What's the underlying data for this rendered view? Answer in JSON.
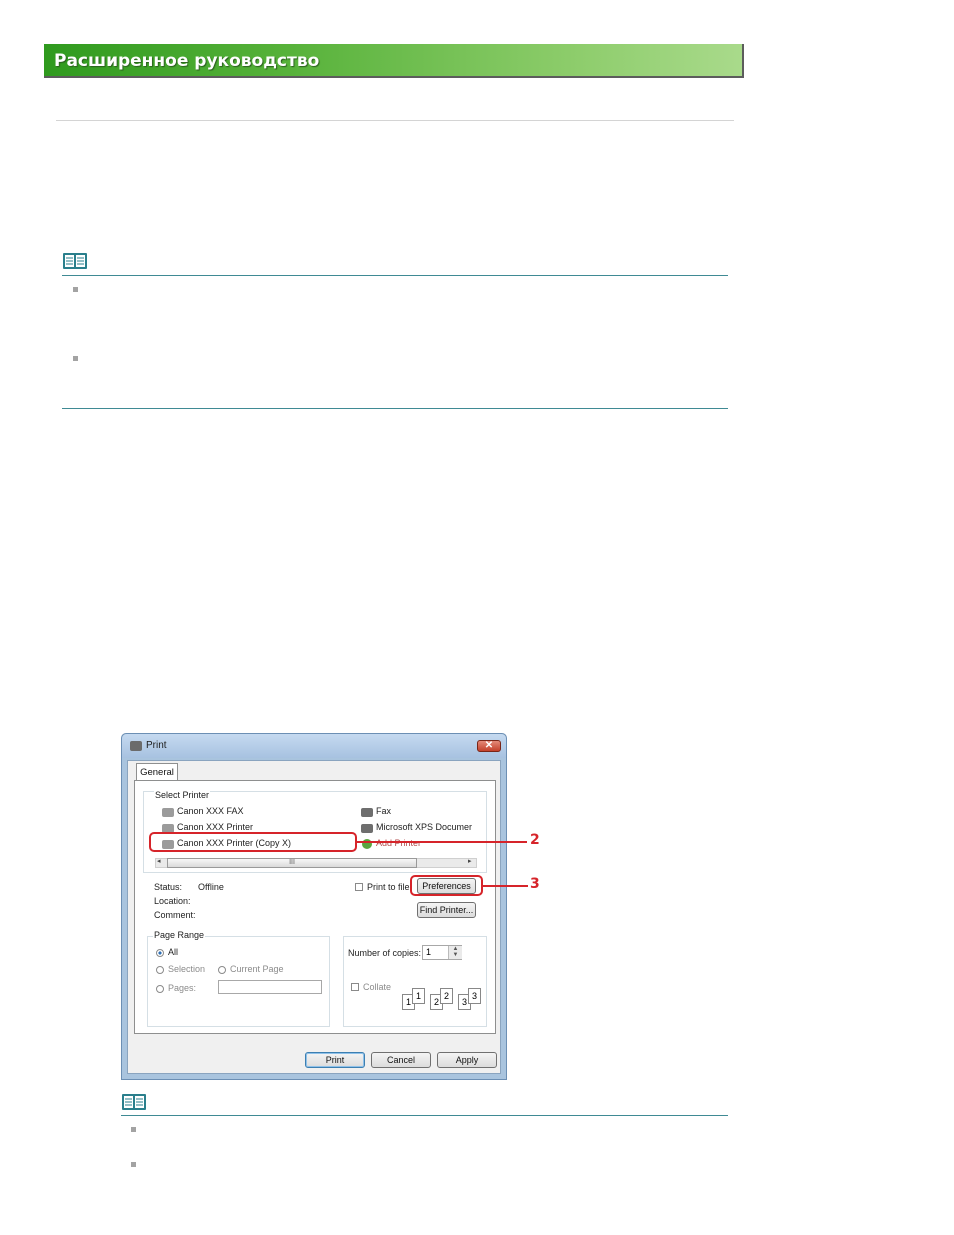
{
  "header": {
    "title": "Расширенное руководство"
  },
  "dialog": {
    "title": "Print",
    "close_label": "✕",
    "tab_general": "General",
    "select_printer_label": "Select Printer",
    "printers_left": [
      "Canon XXX FAX",
      "Canon XXX Printer",
      "Canon XXX Printer (Copy X)"
    ],
    "printers_right": [
      "Fax",
      "Microsoft XPS Documer",
      "Add Printer"
    ],
    "scroll_grip": "III",
    "status_label": "Status:",
    "status_value": "Offline",
    "location_label": "Location:",
    "comment_label": "Comment:",
    "print_to_file_label": "Print to file",
    "preferences_label": "Preferences",
    "find_printer_label": "Find Printer...",
    "page_range_label": "Page Range",
    "range_all": "All",
    "range_selection": "Selection",
    "range_current_page": "Current Page",
    "range_pages": "Pages:",
    "copies_label": "Number of copies:",
    "copies_value": "1",
    "collate_label": "Collate",
    "collate_pages": [
      "1",
      "1",
      "2",
      "2",
      "3",
      "3"
    ],
    "print_button": "Print",
    "cancel_button": "Cancel",
    "apply_button": "Apply"
  },
  "callouts": {
    "printer": "2",
    "preferences": "3"
  },
  "colors": {
    "banner_green": "#57b23a",
    "callout_red": "#d6242a",
    "rule_teal": "#3f8a94"
  }
}
